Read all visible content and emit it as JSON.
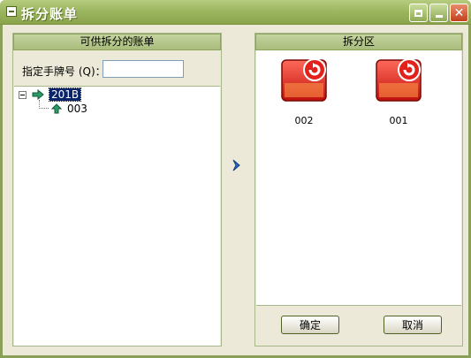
{
  "window": {
    "title": "拆分账单"
  },
  "left_panel": {
    "header": "可供拆分的账单",
    "search_label": "指定手牌号 (Q)：",
    "search_value": "",
    "tree": {
      "root": {
        "label": "201B",
        "expanded": true,
        "selected": true
      },
      "children": [
        {
          "label": "003"
        }
      ]
    }
  },
  "right_panel": {
    "header": "拆分区",
    "items": [
      {
        "label": "002",
        "icon": "bill-red-icon"
      },
      {
        "label": "001",
        "icon": "bill-red-icon"
      }
    ],
    "confirm_label": "确定",
    "cancel_label": "取消"
  },
  "colors": {
    "titlebar": "#9db761",
    "panel_header": "#b8c98f",
    "selection": "#0a246a",
    "bill_red": "#d9231e",
    "arrow_blue": "#2a6ad0"
  }
}
